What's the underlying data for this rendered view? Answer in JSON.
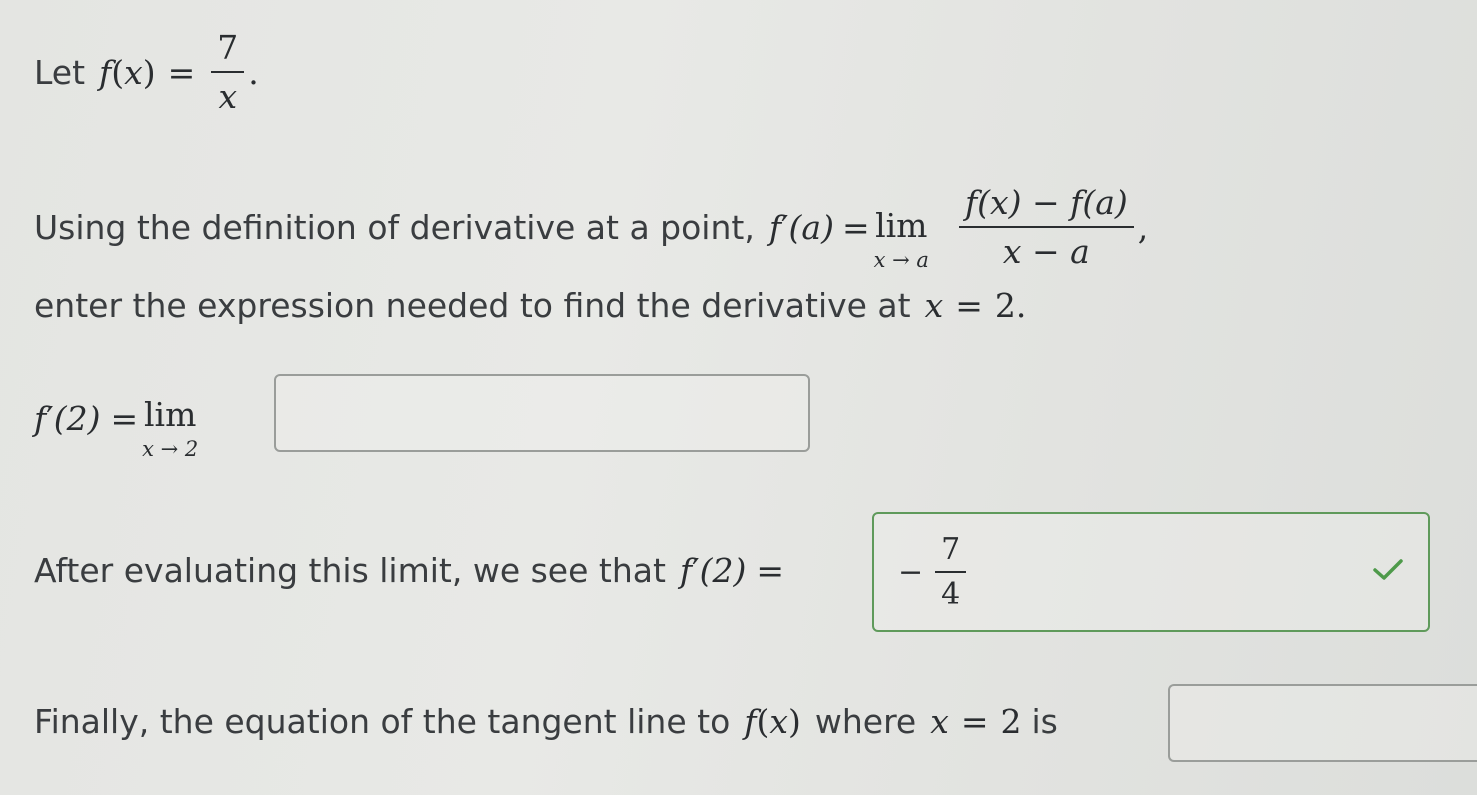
{
  "line1": {
    "prefix": "Let",
    "f": "f",
    "x": "x",
    "paren_open": "(",
    "paren_close": ")",
    "equals": "=",
    "numerator": "7",
    "denominator": "x",
    "suffix": "."
  },
  "line2": {
    "text": "Using the definition of derivative at a point,",
    "lhs_f": "f",
    "lhs_prime": "′",
    "lhs_arg": "(a)",
    "equals": "=",
    "lim": "lim",
    "lim_sub": "x → a",
    "numerator": "f(x) − f(a)",
    "denominator": "x − a",
    "trailing": ","
  },
  "line3": {
    "text": "enter the expression needed to find the derivative at",
    "var": "x",
    "equals": "=",
    "value": "2."
  },
  "line4": {
    "lhs_f": "f",
    "lhs_prime": "′",
    "lhs_arg": "(2)",
    "equals": "=",
    "lim": "lim",
    "lim_sub": "x → 2",
    "input_value": ""
  },
  "line5": {
    "text": "After evaluating this limit, we see that",
    "lhs_f": "f",
    "lhs_prime": "′",
    "lhs_arg": "(2)",
    "equals": "=",
    "answer_sign": "−",
    "answer_numerator": "7",
    "answer_denominator": "4",
    "status": "correct"
  },
  "line6": {
    "text": "Finally, the equation of the tangent line to",
    "f": "f",
    "x": "x",
    "paren_open": "(",
    "paren_close": ")",
    "where": "where",
    "var": "x",
    "equals": "=",
    "value": "2",
    "is": "is",
    "input_value": ""
  },
  "colors": {
    "correct_border": "#5f9a5b",
    "check_mark": "#4e9a4a",
    "input_border": "#9a9d9a"
  }
}
